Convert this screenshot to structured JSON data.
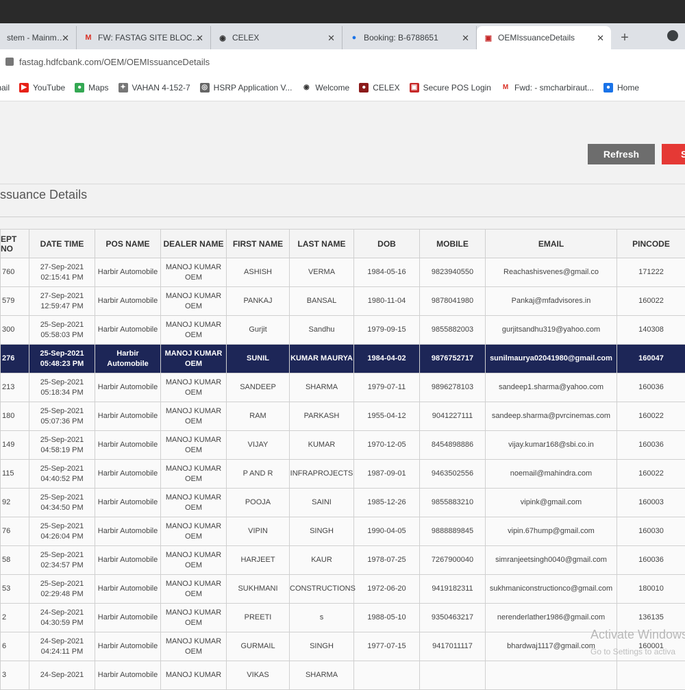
{
  "browser": {
    "tabs": [
      {
        "title": "stem - Mainmenu",
        "icon": "generic-icon",
        "active": false
      },
      {
        "title": "FW: FASTAG SITE BLOCKED - sm",
        "icon": "gmail-icon",
        "active": false
      },
      {
        "title": "CELEX",
        "icon": "globe-icon",
        "active": false
      },
      {
        "title": "Booking: B-6788651",
        "icon": "booking-icon",
        "active": false
      },
      {
        "title": "OEMIssuanceDetails",
        "icon": "hdfc-icon",
        "active": true
      }
    ],
    "new_tab_label": "+",
    "url": "fastag.hdfcbank.com/OEM/OEMIssuanceDetails",
    "bookmarks": [
      {
        "label": "mail",
        "icon": "mail-icon"
      },
      {
        "label": "YouTube",
        "icon": "youtube-icon"
      },
      {
        "label": "Maps",
        "icon": "maps-icon"
      },
      {
        "label": "VAHAN 4-152-7",
        "icon": "vahan-icon"
      },
      {
        "label": "HSRP Application V...",
        "icon": "hsrp-icon"
      },
      {
        "label": "Welcome",
        "icon": "globe-icon"
      },
      {
        "label": "CELEX",
        "icon": "celex-icon"
      },
      {
        "label": "Secure POS Login",
        "icon": "pos-icon"
      },
      {
        "label": "Fwd: - smcharbiraut...",
        "icon": "gmail-icon"
      },
      {
        "label": "Home",
        "icon": "home-icon"
      }
    ]
  },
  "page": {
    "refresh_label": "Refresh",
    "red_button_label": "S",
    "title": "ssuance Details",
    "columns": [
      "EPT NO",
      "DATE TIME",
      "POS NAME",
      "DEALER NAME",
      "FIRST NAME",
      "LAST NAME",
      "DOB",
      "MOBILE",
      "EMAIL",
      "PINCODE"
    ],
    "rows": [
      {
        "rcpt": "760",
        "date": "27-Sep-2021",
        "time": "02:15:41 PM",
        "pos": "Harbir Automobile",
        "dealer1": "MANOJ KUMAR",
        "dealer2": "OEM",
        "first": "ASHISH",
        "last": "VERMA",
        "dob": "1984-05-16",
        "mobile": "9823940550",
        "email": "Reachashisvenes@gmail.co",
        "pin": "171222",
        "selected": false
      },
      {
        "rcpt": "579",
        "date": "27-Sep-2021",
        "time": "12:59:47 PM",
        "pos": "Harbir Automobile",
        "dealer1": "MANOJ KUMAR",
        "dealer2": "OEM",
        "first": "PANKAJ",
        "last": "BANSAL",
        "dob": "1980-11-04",
        "mobile": "9878041980",
        "email": "Pankaj@mfadvisores.in",
        "pin": "160022",
        "selected": false
      },
      {
        "rcpt": "300",
        "date": "25-Sep-2021",
        "time": "05:58:03 PM",
        "pos": "Harbir Automobile",
        "dealer1": "MANOJ KUMAR",
        "dealer2": "OEM",
        "first": "Gurjit",
        "last": "Sandhu",
        "dob": "1979-09-15",
        "mobile": "9855882003",
        "email": "gurjitsandhu319@yahoo.com",
        "pin": "140308",
        "selected": false
      },
      {
        "rcpt": "276",
        "date": "25-Sep-2021",
        "time": "05:48:23 PM",
        "pos": "Harbir Automobile",
        "dealer1": "MANOJ KUMAR",
        "dealer2": "OEM",
        "first": "SUNIL",
        "last": "KUMAR MAURYA",
        "dob": "1984-04-02",
        "mobile": "9876752717",
        "email": "sunilmaurya02041980@gmail.com",
        "pin": "160047",
        "selected": true
      },
      {
        "rcpt": "213",
        "date": "25-Sep-2021",
        "time": "05:18:34 PM",
        "pos": "Harbir Automobile",
        "dealer1": "MANOJ KUMAR",
        "dealer2": "OEM",
        "first": "SANDEEP",
        "last": "SHARMA",
        "dob": "1979-07-11",
        "mobile": "9896278103",
        "email": "sandeep1.sharma@yahoo.com",
        "pin": "160036",
        "selected": false
      },
      {
        "rcpt": "180",
        "date": "25-Sep-2021",
        "time": "05:07:36 PM",
        "pos": "Harbir Automobile",
        "dealer1": "MANOJ KUMAR",
        "dealer2": "OEM",
        "first": "RAM",
        "last": "PARKASH",
        "dob": "1955-04-12",
        "mobile": "9041227111",
        "email": "sandeep.sharma@pvrcinemas.com",
        "pin": "160022",
        "selected": false
      },
      {
        "rcpt": "149",
        "date": "25-Sep-2021",
        "time": "04:58:19 PM",
        "pos": "Harbir Automobile",
        "dealer1": "MANOJ KUMAR",
        "dealer2": "OEM",
        "first": "VIJAY",
        "last": "KUMAR",
        "dob": "1970-12-05",
        "mobile": "8454898886",
        "email": "vijay.kumar168@sbi.co.in",
        "pin": "160036",
        "selected": false
      },
      {
        "rcpt": "115",
        "date": "25-Sep-2021",
        "time": "04:40:52 PM",
        "pos": "Harbir Automobile",
        "dealer1": "MANOJ KUMAR",
        "dealer2": "OEM",
        "first": "P AND R",
        "last": "INFRAPROJECTS",
        "dob": "1987-09-01",
        "mobile": "9463502556",
        "email": "noemail@mahindra.com",
        "pin": "160022",
        "selected": false
      },
      {
        "rcpt": "92",
        "date": "25-Sep-2021",
        "time": "04:34:50 PM",
        "pos": "Harbir Automobile",
        "dealer1": "MANOJ KUMAR",
        "dealer2": "OEM",
        "first": "POOJA",
        "last": "SAINI",
        "dob": "1985-12-26",
        "mobile": "9855883210",
        "email": "vipink@gmail.com",
        "pin": "160003",
        "selected": false
      },
      {
        "rcpt": "76",
        "date": "25-Sep-2021",
        "time": "04:26:04 PM",
        "pos": "Harbir Automobile",
        "dealer1": "MANOJ KUMAR",
        "dealer2": "OEM",
        "first": "VIPIN",
        "last": "SINGH",
        "dob": "1990-04-05",
        "mobile": "9888889845",
        "email": "vipin.67hump@gmail.com",
        "pin": "160030",
        "selected": false
      },
      {
        "rcpt": "58",
        "date": "25-Sep-2021",
        "time": "02:34:57 PM",
        "pos": "Harbir Automobile",
        "dealer1": "MANOJ KUMAR",
        "dealer2": "OEM",
        "first": "HARJEET",
        "last": "KAUR",
        "dob": "1978-07-25",
        "mobile": "7267900040",
        "email": "simranjeetsingh0040@gmail.com",
        "pin": "160036",
        "selected": false
      },
      {
        "rcpt": "53",
        "date": "25-Sep-2021",
        "time": "02:29:48 PM",
        "pos": "Harbir Automobile",
        "dealer1": "MANOJ KUMAR",
        "dealer2": "OEM",
        "first": "SUKHMANI",
        "last": "CONSTRUCTIONS",
        "dob": "1972-06-20",
        "mobile": "9419182311",
        "email": "sukhmaniconstructionco@gmail.com",
        "pin": "180010",
        "selected": false
      },
      {
        "rcpt": "2",
        "date": "24-Sep-2021",
        "time": "04:30:59 PM",
        "pos": "Harbir Automobile",
        "dealer1": "MANOJ KUMAR",
        "dealer2": "OEM",
        "first": "PREETI",
        "last": "s",
        "dob": "1988-05-10",
        "mobile": "9350463217",
        "email": "nerenderlather1986@gmail.com",
        "pin": "136135",
        "selected": false
      },
      {
        "rcpt": "6",
        "date": "24-Sep-2021",
        "time": "04:24:11 PM",
        "pos": "Harbir Automobile",
        "dealer1": "MANOJ KUMAR",
        "dealer2": "OEM",
        "first": "GURMAIL",
        "last": "SINGH",
        "dob": "1977-07-15",
        "mobile": "9417011117",
        "email": "bhardwaj1117@gmail.com",
        "pin": "160001",
        "selected": false
      },
      {
        "rcpt": "3",
        "date": "24-Sep-2021",
        "time": "",
        "pos": "Harbir Automobile",
        "dealer1": "MANOJ KUMAR",
        "dealer2": "",
        "first": "VIKAS",
        "last": "SHARMA",
        "dob": "",
        "mobile": "",
        "email": "",
        "pin": "",
        "selected": false
      }
    ]
  },
  "overlay": {
    "watermark": "Activate Windows",
    "watermark_sub": "Go to Settings to activa"
  },
  "colors": {
    "selected_row": "#1d2657",
    "refresh_button": "#6d6d6d",
    "red_button": "#e53935"
  }
}
